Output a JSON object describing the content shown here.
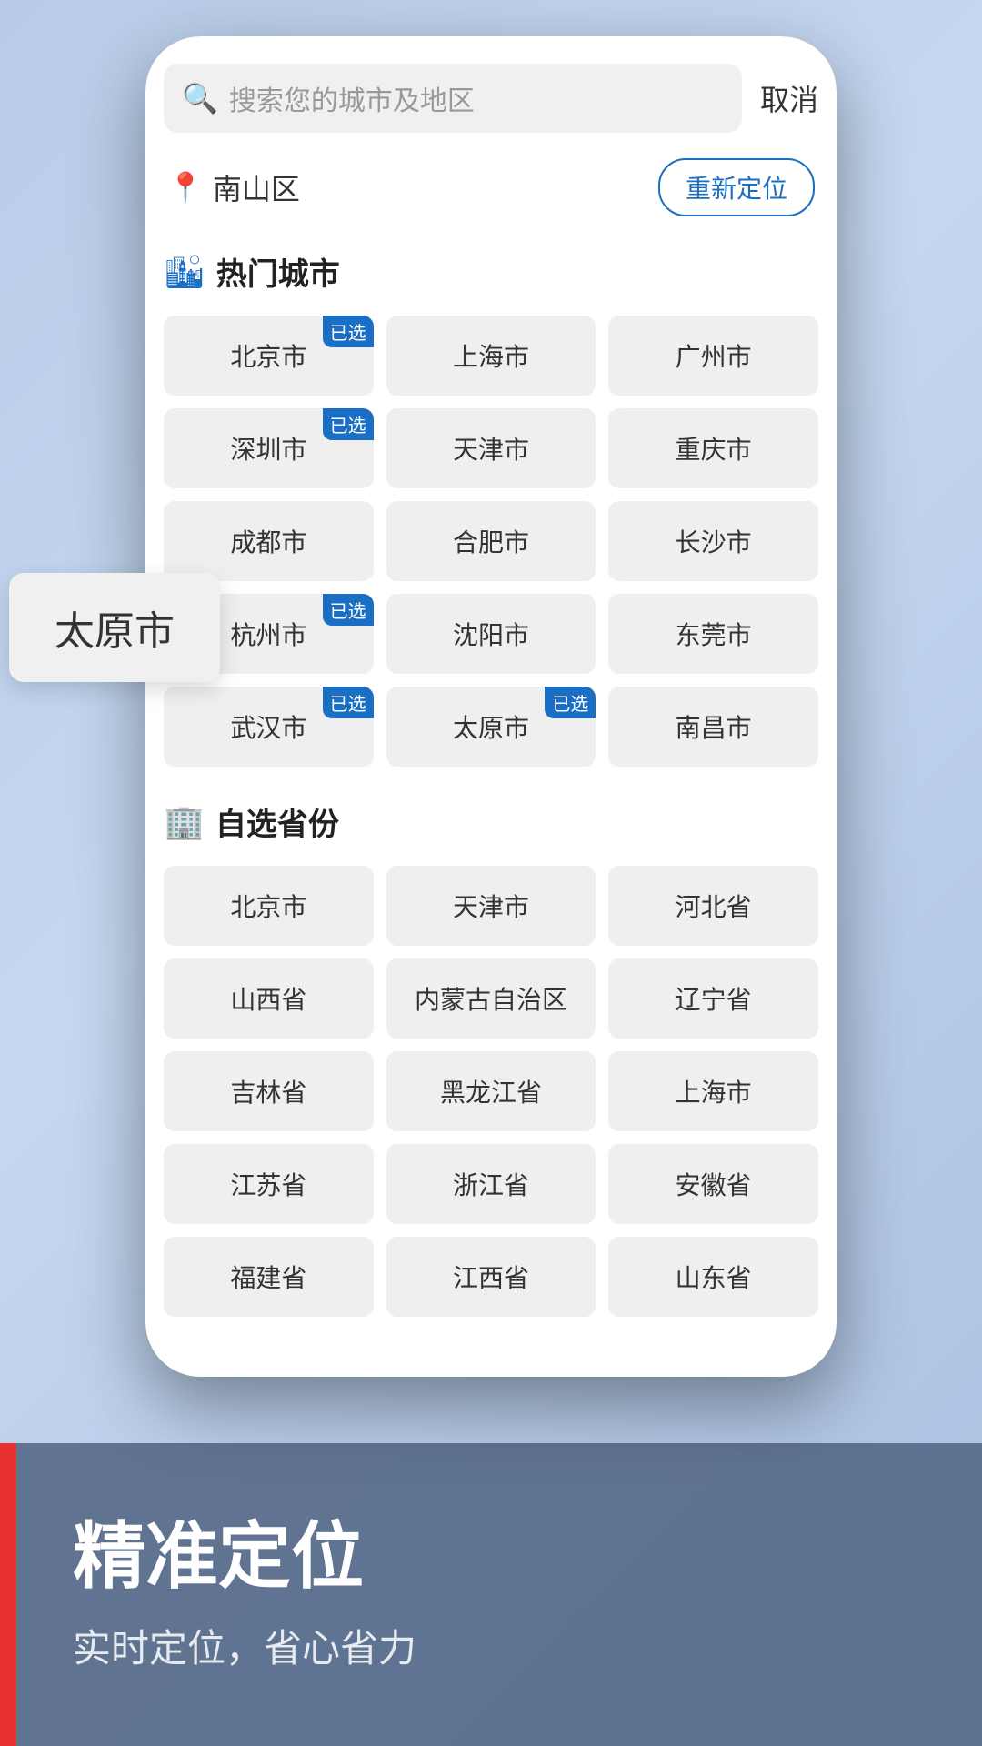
{
  "search": {
    "placeholder": "搜索您的城市及地区",
    "cancel_label": "取消"
  },
  "location": {
    "current": "南山区",
    "relocate_label": "重新定位"
  },
  "hot_cities": {
    "title": "热门城市",
    "cities": [
      {
        "name": "北京市",
        "selected": true
      },
      {
        "name": "上海市",
        "selected": false
      },
      {
        "name": "广州市",
        "selected": false
      },
      {
        "name": "深圳市",
        "selected": true
      },
      {
        "name": "天津市",
        "selected": false
      },
      {
        "name": "重庆市",
        "selected": false
      },
      {
        "name": "成都市",
        "selected": false
      },
      {
        "name": "合肥市",
        "selected": false
      },
      {
        "name": "长沙市",
        "selected": false
      },
      {
        "name": "杭州市",
        "selected": true
      },
      {
        "name": "沈阳市",
        "selected": false
      },
      {
        "name": "东莞市",
        "selected": false
      },
      {
        "name": "武汉市",
        "selected": true
      },
      {
        "name": "太原市",
        "selected": true
      },
      {
        "name": "南昌市",
        "selected": false
      }
    ]
  },
  "province": {
    "title": "自选省份",
    "provinces": [
      {
        "name": "北京市",
        "selected": false
      },
      {
        "name": "天津市",
        "selected": false
      },
      {
        "name": "河北省",
        "selected": false
      },
      {
        "name": "山西省",
        "selected": false
      },
      {
        "name": "内蒙古自治区",
        "selected": false
      },
      {
        "name": "辽宁省",
        "selected": false
      },
      {
        "name": "吉林省",
        "selected": false
      },
      {
        "name": "黑龙江省",
        "selected": false
      },
      {
        "name": "上海市",
        "selected": false
      },
      {
        "name": "江苏省",
        "selected": false
      },
      {
        "name": "浙江省",
        "selected": false
      },
      {
        "name": "安徽省",
        "selected": false
      },
      {
        "name": "福建省",
        "selected": false
      },
      {
        "name": "江西省",
        "selected": false
      },
      {
        "name": "山东省",
        "selected": false
      }
    ]
  },
  "tooltip": {
    "text": "太原市"
  },
  "promo": {
    "title": "精准定位",
    "subtitle": "实时定位，省心省力"
  }
}
